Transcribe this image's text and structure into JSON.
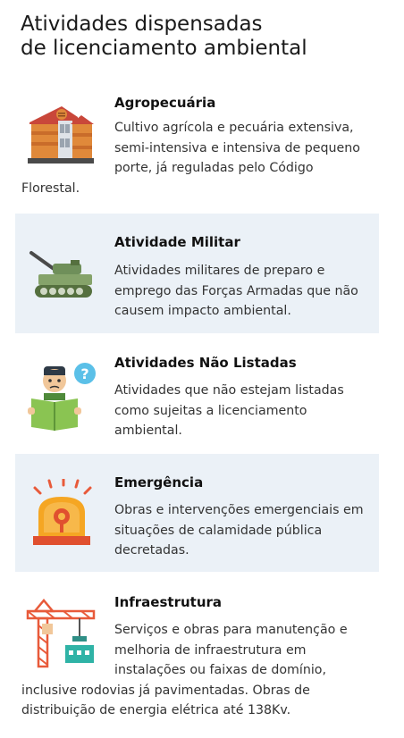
{
  "page": {
    "title_line1": "Atividades dispensadas",
    "title_line2": "de licenciamento ambiental"
  },
  "items": [
    {
      "icon": "farm-buildings-icon",
      "title": "Agropecuária",
      "description": "Cultivo agrícola e pecuária extensiva, semi-intensiva e intensiva de pequeno porte, já reguladas pelo Código Florestal."
    },
    {
      "icon": "military-tank-icon",
      "title": "Atividade Militar",
      "description": "Atividades militares de preparo e emprego das Forças Armadas que não causem impacto ambiental."
    },
    {
      "icon": "confused-person-reading-icon",
      "title": "Atividades Não Listadas",
      "description": "Atividades que não estejam listadas como sujeitas a licenciamento ambiental."
    },
    {
      "icon": "emergency-siren-icon",
      "title": "Emergência",
      "description": "Obras e intervenções emergenciais em situações de calamidade pública decretadas."
    },
    {
      "icon": "construction-crane-icon",
      "title": "Infraestrutura",
      "description": "Serviços e obras para manutenção e melhoria de infraestrutura em instalações ou faixas de domínio, inclusive rodovias já pavimentadas. Obras de distribuição de energia elétrica até 138Kv."
    }
  ]
}
